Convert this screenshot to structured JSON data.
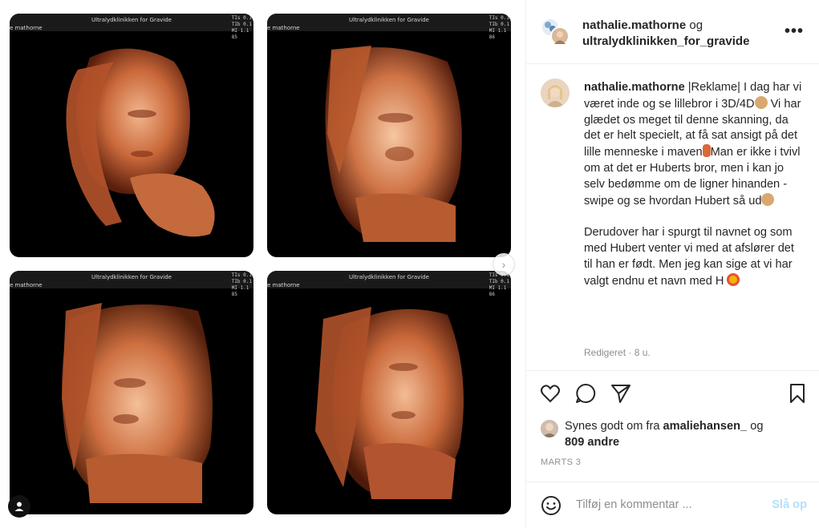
{
  "scans": [
    {
      "title": "Ultralydklinikken for Gravide",
      "name": "e mathorne",
      "vals": [
        "TIs 0.1",
        "TIb 0.1",
        "MI 1.1"
      ],
      "code": "85"
    },
    {
      "title": "Ultralydklinikken for Gravide",
      "name": "e mathorne",
      "vals": [
        "TIs 0.1",
        "TIb 0.1",
        "MI 1.1"
      ],
      "code": "86"
    },
    {
      "title": "Ultralydklinikken for Gravide",
      "name": "e mathorne",
      "vals": [
        "TIs 0.1",
        "TIb 0.1",
        "MI 1.1"
      ],
      "code": "85"
    },
    {
      "title": "Ultralydklinikken for Gravide",
      "name": "e mathorne",
      "vals": [
        "TIs 0.1",
        "TIb 0.1",
        "MI 1.1"
      ],
      "code": "86"
    }
  ],
  "header": {
    "user1": "nathalie.mathorne",
    "joiner": "og",
    "user2": "ultralydklinikken_for_gravide",
    "more": "•••"
  },
  "caption": {
    "username": "nathalie.mathorne",
    "tag": "|Reklame|",
    "p1a": "I dag har vi været inde og se lillebror i 3D/4D",
    "p1b": " Vi har glædet os meget til denne skanning, da det er helt specielt, at få sat ansigt på det lille menneske i maven",
    "p1c": "Man er ikke i tvivl om at det er Huberts bror, men i kan jo selv bedømme om de ligner hinanden - swipe og se hvordan Hubert så ud",
    "p2": "Derudover har i spurgt til navnet og som med Hubert venter vi med at afslører det til han er født. Men jeg kan sige at vi har valgt endnu et navn med H ",
    "edited": "Redigeret · 8 u."
  },
  "likes": {
    "prefix": "Synes godt om fra",
    "user": "amaliehansen_",
    "joiner": "og",
    "others": "809 andre"
  },
  "date": "MARTS 3",
  "comment": {
    "placeholder": "Tilføj en kommentar ...",
    "post": "Slå op"
  },
  "icons": [
    "heart-icon",
    "comment-icon",
    "share-icon",
    "bookmark-icon",
    "smile-icon",
    "chevron-right-icon",
    "user-tag-icon"
  ],
  "colors": {
    "link": "#b2dffc",
    "muted": "#8e8e8e",
    "text": "#262626",
    "skin": "#d9895b"
  }
}
